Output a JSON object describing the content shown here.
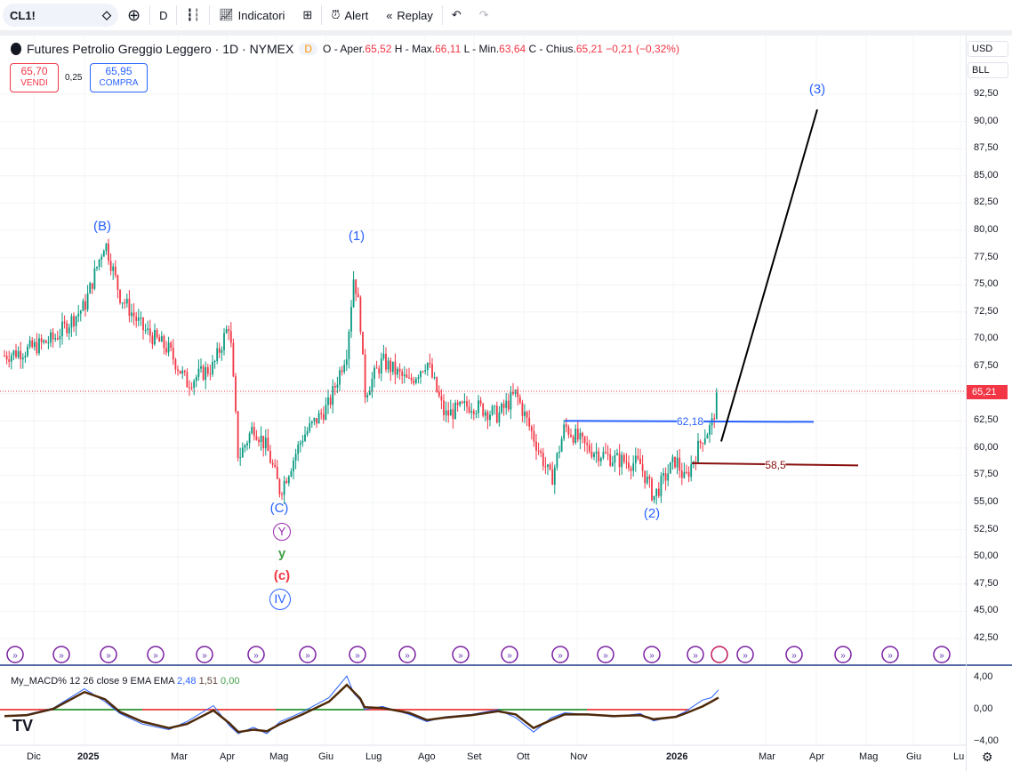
{
  "toolbar": {
    "symbol": "CL1!",
    "interval": "D",
    "indicators": "Indicatori",
    "alert": "Alert",
    "replay": "Replay"
  },
  "legend": {
    "title": "Futures Petrolio Greggio Leggero · 1D · NYMEX",
    "badge": "D",
    "o_label": "O - Aper.",
    "o": "65,52",
    "h_label": "H - Max.",
    "h": "66,11",
    "l_label": "L - Min.",
    "l": "63,64",
    "c_label": "C - Chius.",
    "c": "65,21",
    "chg": "−0,21 (−0,32%)"
  },
  "trade": {
    "sell_price": "65,70",
    "sell_label": "VENDI",
    "spread": "0,25",
    "buy_price": "65,95",
    "buy_label": "COMPRA"
  },
  "axis": {
    "currency": "USD",
    "unit": "BLL",
    "last_price": "65,21",
    "macd_ticks": [
      "4,00",
      "0,00",
      "−4,00"
    ]
  },
  "annotations": {
    "B": "(B)",
    "w1": "(1)",
    "C": "(C)",
    "Y": "Y",
    "y": "y",
    "c": "(c)",
    "IV": "IV",
    "w2": "(2)",
    "w3": "(3)",
    "lvl1": "62,18",
    "lvl2": "58,5"
  },
  "macd": {
    "label": "My_MACD% 12 26 close 9 EMA EMA",
    "macd": "2,48",
    "signal": "1,51",
    "hist": "0,00"
  },
  "chart_data": {
    "type": "candlestick",
    "price_ticks": [
      92.5,
      90,
      87.5,
      85,
      82.5,
      80,
      77.5,
      75,
      72.5,
      70,
      67.5,
      65,
      62.5,
      60,
      57.5,
      55,
      52.5,
      50,
      47.5,
      45,
      42.5
    ],
    "price_tick_labels": [
      "92,50",
      "90,00",
      "87,50",
      "85,00",
      "82,50",
      "80,00",
      "77,50",
      "75,00",
      "72,50",
      "70,00",
      "67,50",
      "65,00",
      "62,50",
      "60,00",
      "57,50",
      "55,00",
      "52,50",
      "50,00",
      "47,50",
      "45,00",
      "42,50"
    ],
    "x_labels": [
      "Dic",
      "2025",
      "Mar",
      "Apr",
      "Mag",
      "Giu",
      "Lug",
      "Ago",
      "Set",
      "Ott",
      "Nov",
      "2026",
      "Mar",
      "Apr",
      "Mag",
      "Giu",
      "Lu"
    ],
    "close_path": [
      68.5,
      69,
      70,
      73,
      79,
      74,
      71,
      69,
      66,
      67.5,
      71.5,
      59,
      62,
      60,
      56,
      61,
      64,
      69,
      76,
      72,
      65,
      68,
      66,
      68,
      63,
      64,
      63,
      65,
      61,
      57,
      62,
      60,
      59,
      58.5,
      55.5,
      59,
      57,
      61,
      62,
      65.2
    ],
    "macd_path": [
      -0.8,
      -0.6,
      0.2,
      2.6,
      1,
      -0.5,
      -1.8,
      -2.5,
      -1.5,
      0.5,
      -2,
      -3,
      -2.2,
      -3,
      -1.5,
      -0.3,
      1.5,
      4.2,
      2,
      1.2,
      0,
      0.4,
      -0.6,
      -1.5,
      -0.9,
      -0.6,
      0,
      -1,
      -2.8,
      -1,
      -0.4,
      -0.6,
      -0.9,
      -0.5,
      -1.4,
      -0.8,
      -0.3,
      1.2,
      1.5,
      2.48
    ],
    "signal_path": [
      -0.8,
      -0.7,
      0.1,
      2.2,
      1.3,
      -0.3,
      -1.5,
      -2.3,
      -1.8,
      -0.1,
      -1.7,
      -2.8,
      -2.5,
      -2.7,
      -1.8,
      -0.6,
      1,
      3.1,
      2.2,
      1.4,
      0.3,
      0.2,
      -0.4,
      -1.3,
      -1,
      -0.7,
      -0.2,
      -0.6,
      -2.3,
      -1.3,
      -0.6,
      -0.6,
      -0.8,
      -0.7,
      -1.2,
      -0.9,
      -0.5,
      0.4,
      1,
      1.51
    ]
  }
}
